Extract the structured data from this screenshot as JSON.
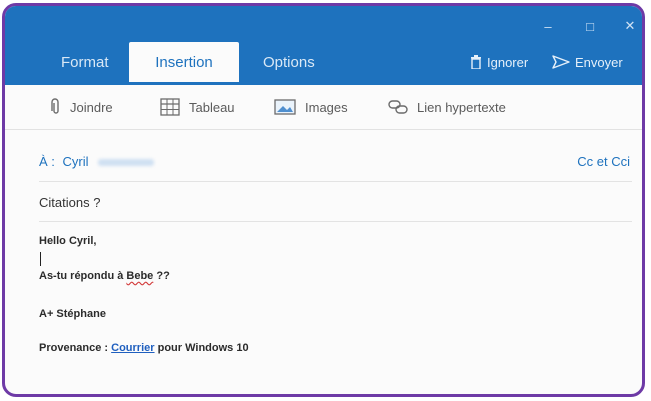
{
  "window": {
    "minimize": "–",
    "maximize": "□",
    "close": "✕"
  },
  "tabs": [
    {
      "label": "Format"
    },
    {
      "label": "Insertion"
    },
    {
      "label": "Options"
    }
  ],
  "actions": {
    "discard": "Ignorer",
    "send": "Envoyer"
  },
  "ribbon": {
    "attach": "Joindre",
    "table": "Tableau",
    "images": "Images",
    "link": "Lien hypertexte"
  },
  "to": {
    "label": "À :",
    "recipient": "Cyril",
    "cc_toggle": "Cc et Cci"
  },
  "subject": "Citations ?",
  "message": {
    "greeting": "Hello Cyril,",
    "question_before": "As-tu répondu à ",
    "question_name": "Bebe",
    "question_after": " ??",
    "signature": "A+ Stéphane",
    "footer_prefix": "Provenance : ",
    "footer_link": "Courrier",
    "footer_suffix": " pour Windows 10"
  },
  "colors": {
    "accent": "#1e72be",
    "frame": "#6e3aa6"
  }
}
